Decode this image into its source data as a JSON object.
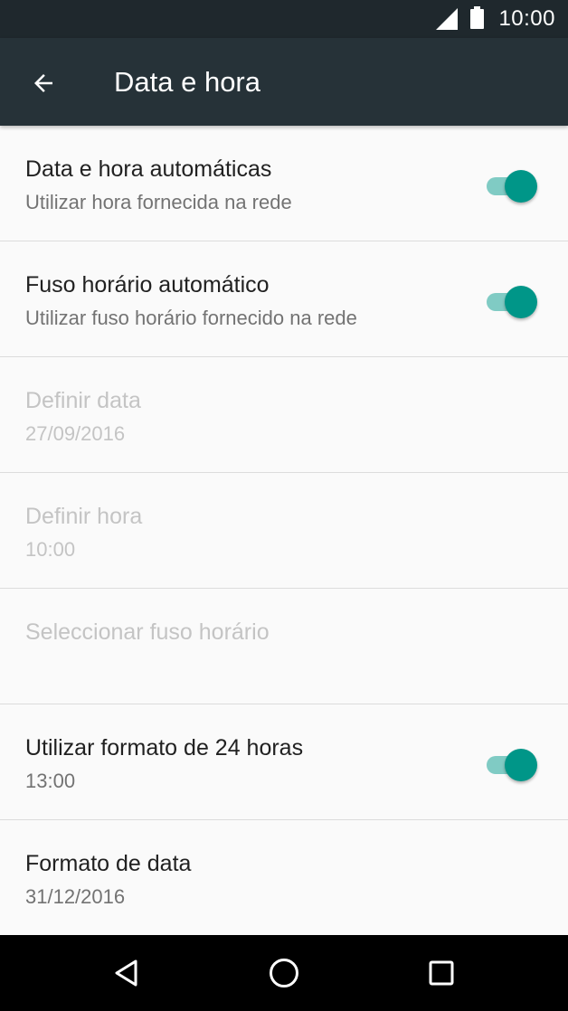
{
  "status_bar": {
    "time": "10:00",
    "icons": [
      "signal-icon",
      "battery-icon"
    ]
  },
  "app_bar": {
    "title": "Data e hora",
    "back_icon": "arrow-back-icon"
  },
  "settings": {
    "items": [
      {
        "title": "Data e hora automáticas",
        "summary": "Utilizar hora fornecida na rede",
        "toggle": true,
        "enabled": true
      },
      {
        "title": "Fuso horário automático",
        "summary": "Utilizar fuso horário fornecido na rede",
        "toggle": true,
        "enabled": true
      },
      {
        "title": "Definir data",
        "summary": "27/09/2016",
        "toggle": null,
        "enabled": false
      },
      {
        "title": "Definir hora",
        "summary": "10:00",
        "toggle": null,
        "enabled": false
      },
      {
        "title": "Seleccionar fuso horário",
        "summary": "",
        "toggle": null,
        "enabled": false
      },
      {
        "title": "Utilizar formato de 24 horas",
        "summary": "13:00",
        "toggle": true,
        "enabled": true
      },
      {
        "title": "Formato de data",
        "summary": "31/12/2016",
        "toggle": null,
        "enabled": true
      }
    ]
  },
  "nav_bar": {
    "icons": [
      "back-triangle-icon",
      "home-circle-icon",
      "recents-square-icon"
    ]
  },
  "colors": {
    "status_bar": "#1f282d",
    "app_bar": "#263238",
    "accent": "#009688",
    "accent_track": "#80cbc4",
    "disabled_text": "#c4c4c4"
  }
}
